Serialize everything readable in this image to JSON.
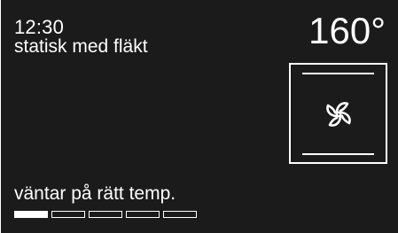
{
  "clock": {
    "time": "12:30"
  },
  "program": {
    "mode": "statisk med fläkt"
  },
  "temperature": {
    "setpoint": "160°"
  },
  "oven_illustration": {
    "icon": "fan-icon",
    "heating_elements": [
      "top",
      "bottom"
    ]
  },
  "status": {
    "text": "väntar på rätt temp."
  },
  "progress": {
    "segments_total": 5,
    "segments_filled": 1,
    "fraction": 0.2
  },
  "colors": {
    "background": "#1b1b1b",
    "foreground": "#ffffff"
  }
}
